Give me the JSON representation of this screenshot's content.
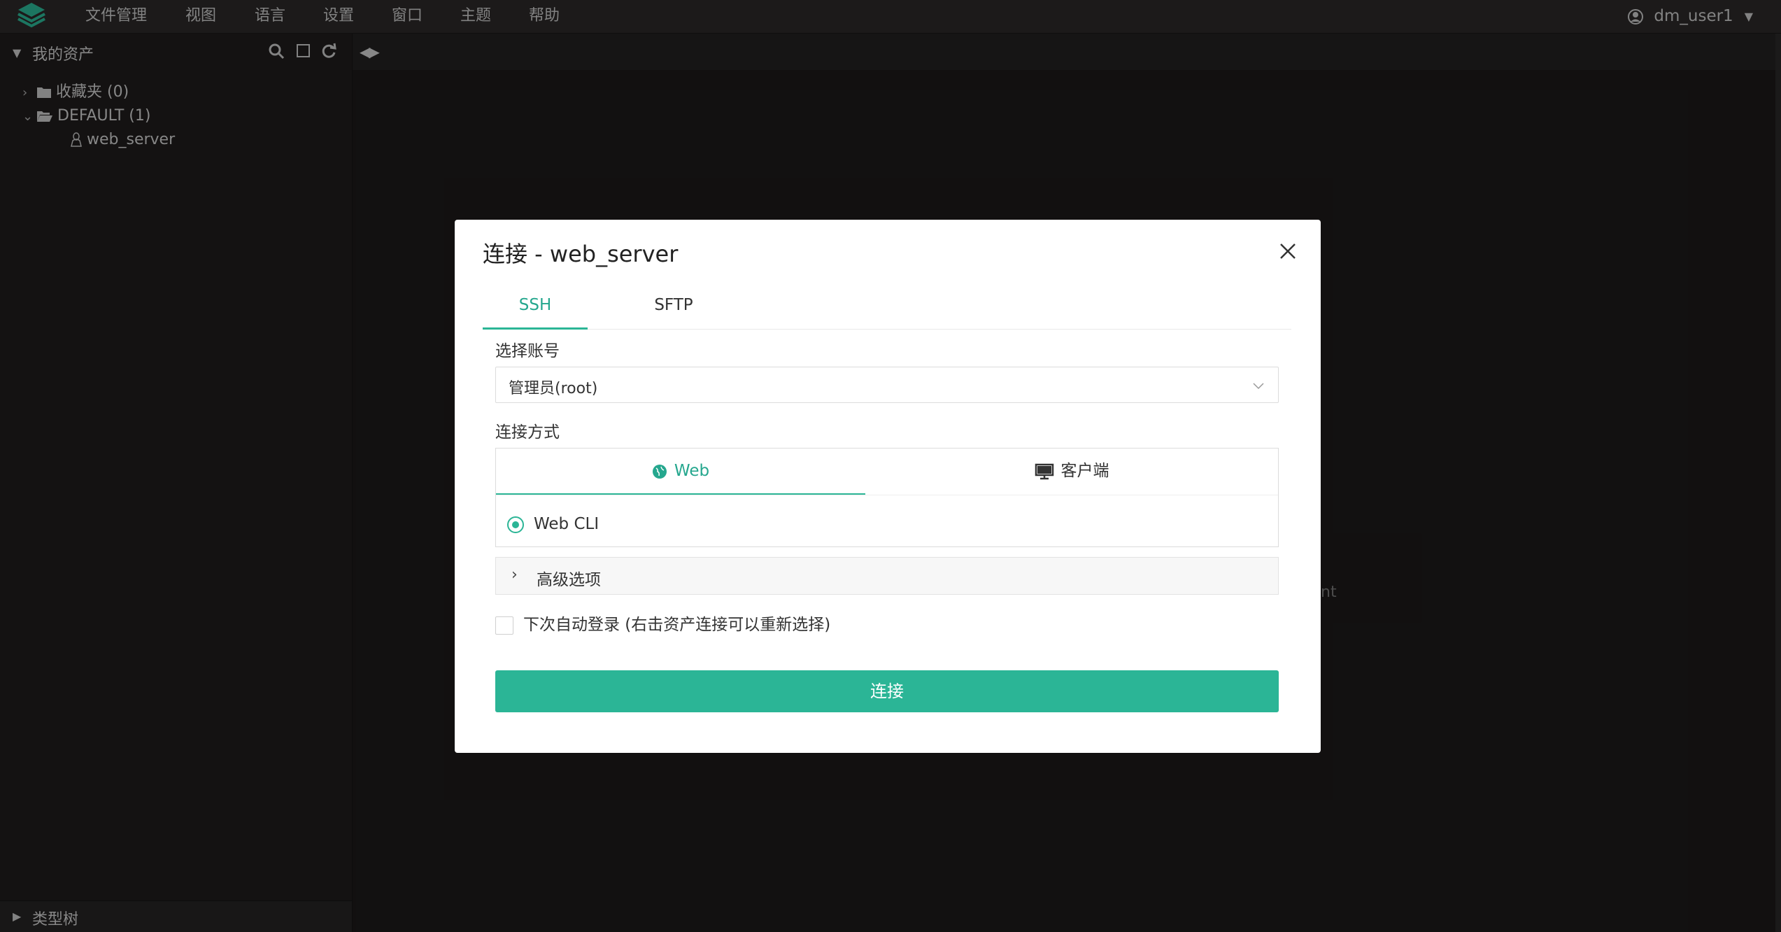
{
  "menubar": {
    "items": [
      "文件管理",
      "视图",
      "语言",
      "设置",
      "窗口",
      "主题",
      "帮助"
    ],
    "user": "dm_user1"
  },
  "sidebar": {
    "title": "我的资产",
    "tree": {
      "favorites": "收藏夹 (0)",
      "default_group": "DEFAULT (1)",
      "asset": "web_server"
    },
    "footer": "类型树"
  },
  "background": {
    "partial_text": "nt"
  },
  "modal": {
    "title": "连接 - web_server",
    "tabs": [
      "SSH",
      "SFTP"
    ],
    "active_tab": "SSH",
    "account_label": "选择账号",
    "account_value": "管理员(root)",
    "method_label": "连接方式",
    "method_tabs": [
      "Web",
      "客户端"
    ],
    "method_option": "Web CLI",
    "advanced": "高级选项",
    "auto_login": "下次自动登录 (右击资产连接可以重新选择)",
    "connect_button": "连接"
  },
  "colors": {
    "accent": "#2bb596",
    "menubar": "#2b2929",
    "sidebar": "#1f1d1d",
    "main": "#1c1a1a"
  }
}
